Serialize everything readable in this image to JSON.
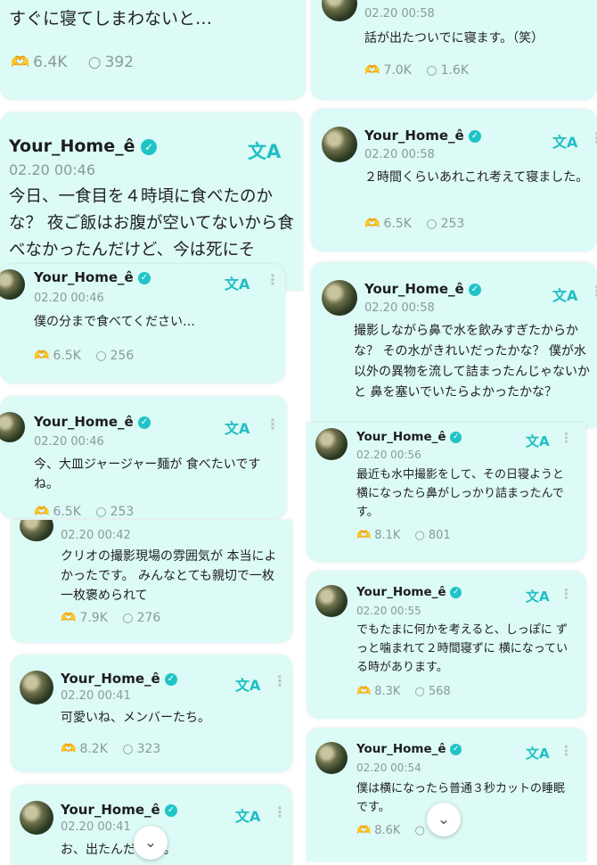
{
  "user": {
    "name": "Your_Home_ê",
    "verified_mark": "✓"
  },
  "icons": {
    "translate": "文A",
    "more": "⋮",
    "likes": "heart-hands-icon",
    "comments": "speech-bubble-icon",
    "expand": "chevron-down-icon"
  },
  "colors": {
    "card": "#dcfaf6",
    "accent": "#1fbfc4"
  },
  "left": {
    "top": {
      "text": "すぐに寝てしまわないと…",
      "likes": "6.4K",
      "comments": "392"
    },
    "main": {
      "date": "02.20 00:46",
      "text": "今日、一食目を４時頃に食べたのかな？ 夜ご飯はお腹が空いてないから食べなかったんだけど、今は死にそ"
    },
    "r1": {
      "date": "02.20 00:46",
      "text": "僕の分まで食べてください…",
      "likes": "6.5K",
      "comments": "256"
    },
    "r2": {
      "date": "02.20 00:46",
      "text": "今、大皿ジャージャー麺が 食べたいですね。",
      "likes": "6.5K",
      "comments": "253"
    },
    "r3": {
      "date": "02.20 00:42",
      "text": "クリオの撮影現場の雰囲気が 本当によかったです。 みんなとても親切で一枚一枚褒められて",
      "likes": "7.9K",
      "comments": "276"
    },
    "r4": {
      "date": "02.20 00:41",
      "text": "可愛いね、メンバーたち。",
      "likes": "8.2K",
      "comments": "323"
    },
    "r5": {
      "date": "02.20 00:41",
      "text": "お、出たんだ  リオ。"
    }
  },
  "right": {
    "c0": {
      "date": "02.20 00:58",
      "text": "話が出たついでに寝ます。（笑）",
      "likes": "7.0K",
      "comments": "1.6K"
    },
    "c1": {
      "date": "02.20 00:58",
      "text": "２時間くらいあれこれ考えて寝ました。",
      "likes": "6.5K",
      "comments": "253"
    },
    "c2": {
      "date": "02.20 00:58",
      "text": "撮影しながら鼻で水を飲みすぎたからかな？ その水がきれいだったかな？ 僕が水以外の異物を流して詰まったんじゃないかと 鼻を塞いでいたらよかったかな？"
    },
    "c3": {
      "date": "02.20 00:56",
      "text": "最近も水中撮影をして、その日寝ようと 横になったら鼻がしっかり詰まったんです。",
      "likes": "8.1K",
      "comments": "801"
    },
    "c4": {
      "date": "02.20 00:55",
      "text": "でもたまに何かを考えると、しっぽに ずっと噛まれて２時間寝ずに 横になっている時があります。",
      "likes": "8.3K",
      "comments": "568"
    },
    "c5": {
      "date": "02.20 00:54",
      "text": "僕は横になったら普通３秒カットの睡眠です。",
      "likes": "8.6K",
      "comments": ""
    }
  }
}
